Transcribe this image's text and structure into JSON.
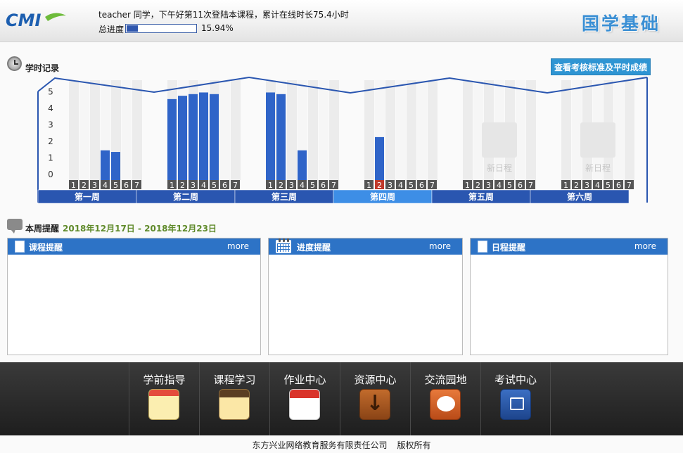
{
  "header": {
    "greeting": "teacher 同学，下午好第11次登陆本课程，累计在线时长75.4小时",
    "progress_label": "总进度",
    "progress_value": 15.94,
    "progress_text": "15.94%",
    "site_title": "国学基础",
    "logo_text": "CMI"
  },
  "study_record": {
    "title": "学时记录",
    "exam_button": "查看考核标准及平时成绩"
  },
  "chart_data": {
    "type": "bar",
    "y_ticks": [
      "5",
      "4",
      "3",
      "2",
      "1",
      "0"
    ],
    "ylim": [
      0,
      5
    ],
    "day_labels": [
      "1",
      "2",
      "3",
      "4",
      "5",
      "6",
      "7"
    ],
    "weeks": [
      {
        "label": "第一周",
        "values": [
          0,
          0,
          0,
          1.8,
          1.7,
          0,
          0
        ],
        "active": false,
        "placeholder": ""
      },
      {
        "label": "第二周",
        "values": [
          4.9,
          5.1,
          5.2,
          5.3,
          5.2,
          0,
          0
        ],
        "active": false,
        "placeholder": ""
      },
      {
        "label": "第三周",
        "values": [
          5.3,
          5.2,
          0,
          1.8,
          0,
          0,
          0
        ],
        "active": false,
        "placeholder": ""
      },
      {
        "label": "第四周",
        "values": [
          0,
          2.6,
          0,
          0,
          0,
          0,
          0
        ],
        "active": true,
        "highlight_day": 2,
        "placeholder": ""
      },
      {
        "label": "第五周",
        "values": [
          0,
          0,
          0,
          0,
          0,
          0,
          0
        ],
        "active": false,
        "placeholder": "新日程"
      },
      {
        "label": "第六周",
        "values": [
          0,
          0,
          0,
          0,
          0,
          0,
          0
        ],
        "active": false,
        "placeholder": "新日程"
      }
    ]
  },
  "weekly": {
    "title": "本周提醒",
    "range": "2018年12月17日 - 2018年12月23日",
    "panels": [
      {
        "title": "课程提醒",
        "more": "more",
        "icon": "document-icon"
      },
      {
        "title": "进度提醒",
        "more": "more",
        "icon": "calendar-icon"
      },
      {
        "title": "日程提醒",
        "more": "more",
        "icon": "note-icon"
      }
    ]
  },
  "nav": {
    "items": [
      {
        "label": "学前指导",
        "icon": "notepad-icon"
      },
      {
        "label": "课程学习",
        "icon": "notebook-icon"
      },
      {
        "label": "作业中心",
        "icon": "calendar-icon"
      },
      {
        "label": "资源中心",
        "icon": "download-icon"
      },
      {
        "label": "交流园地",
        "icon": "chat-icon"
      },
      {
        "label": "考试中心",
        "icon": "exam-icon"
      }
    ]
  },
  "footer": {
    "company": "东方兴业网络教育服务有限责任公司",
    "rights": "版权所有"
  },
  "colors": {
    "accent": "#2d73c6",
    "bar": "#2f64c8",
    "week_bar": "#2a56b0",
    "active_week": "#3d8ee6",
    "highlight_day": "#c0392b",
    "progress_label_green": "#5f8a2a"
  }
}
